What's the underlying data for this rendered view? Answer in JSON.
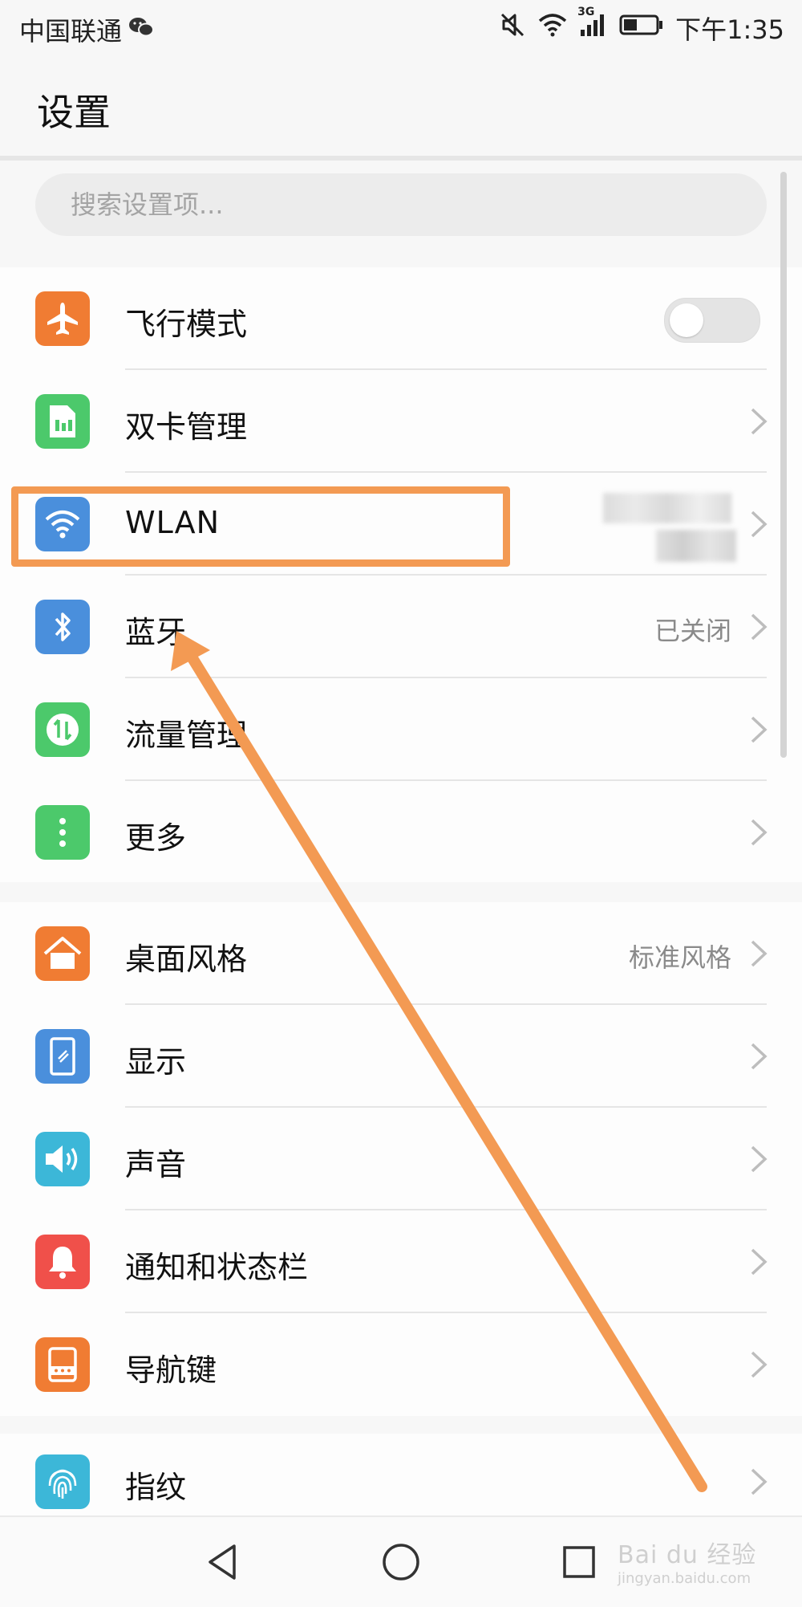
{
  "status": {
    "carrier": "中国联通",
    "network": "3G",
    "time": "下午1:35"
  },
  "header": {
    "title": "设置"
  },
  "search": {
    "placeholder": "搜索设置项..."
  },
  "sections": [
    {
      "rows": [
        {
          "label": "飞行模式",
          "icon": "airplane-icon",
          "color": "#f07c33",
          "toggle": false
        },
        {
          "label": "双卡管理",
          "icon": "sim-card-icon",
          "color": "#4cc96b"
        },
        {
          "label": "WLAN",
          "icon": "wifi-icon",
          "color": "#4a8fdc"
        },
        {
          "label": "蓝牙",
          "icon": "bluetooth-icon",
          "color": "#4a8fdc",
          "value": "已关闭"
        },
        {
          "label": "流量管理",
          "icon": "data-usage-icon",
          "color": "#4cc96b"
        },
        {
          "label": "更多",
          "icon": "more-icon",
          "color": "#4cc96b"
        }
      ]
    },
    {
      "rows": [
        {
          "label": "桌面风格",
          "icon": "home-icon",
          "color": "#f07c33",
          "value": "标准风格"
        },
        {
          "label": "显示",
          "icon": "display-icon",
          "color": "#4a8fdc"
        },
        {
          "label": "声音",
          "icon": "speaker-icon",
          "color": "#3cb7d8"
        },
        {
          "label": "通知和状态栏",
          "icon": "bell-icon",
          "color": "#f0504a"
        },
        {
          "label": "导航键",
          "icon": "nav-key-icon",
          "color": "#f07c33"
        }
      ]
    },
    {
      "rows": [
        {
          "label": "指纹",
          "icon": "fingerprint-icon",
          "color": "#3cb7d8"
        }
      ]
    }
  ],
  "watermark": {
    "text": "Bai du 经验",
    "subtext": "jingyan.baidu.com"
  },
  "colors": {
    "annotation": "#f39a53",
    "chevron": "#bdbdbd",
    "background": "#f7f7f7"
  }
}
